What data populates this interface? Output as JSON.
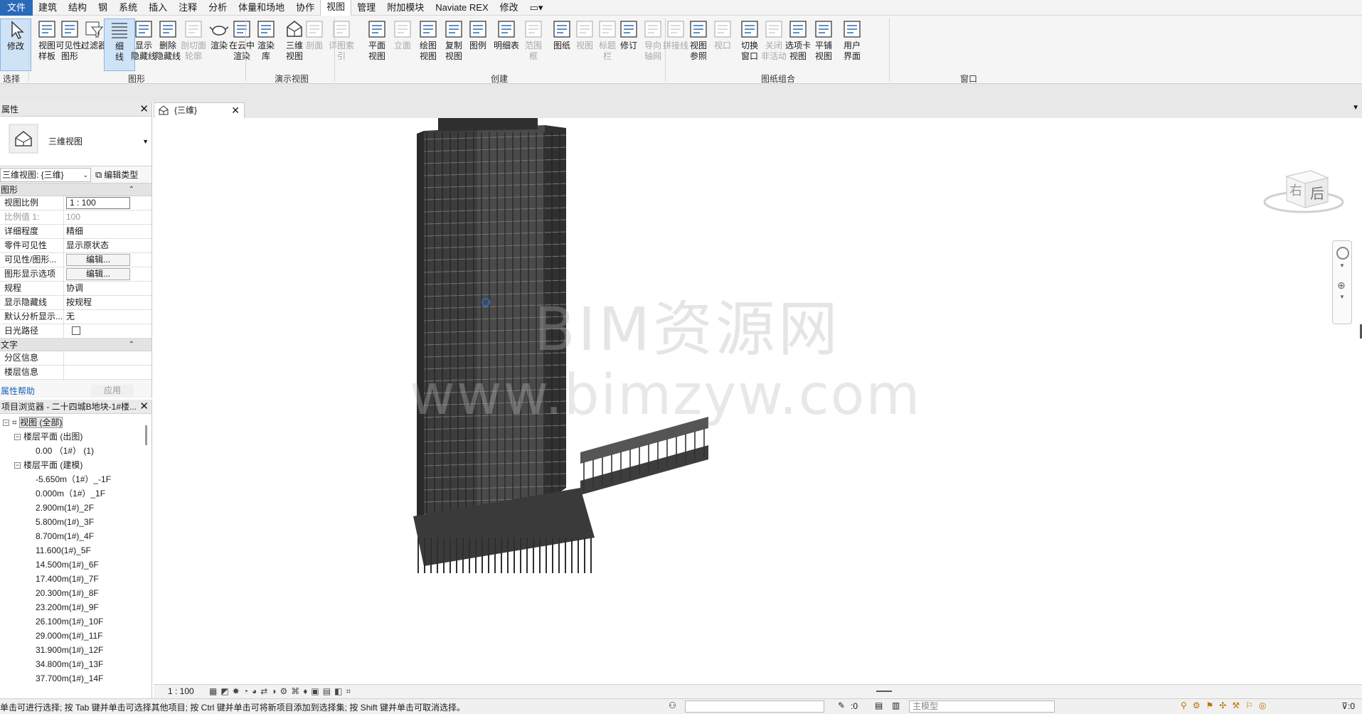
{
  "menu": {
    "tabs": [
      "文件",
      "建筑",
      "结构",
      "钢",
      "系统",
      "插入",
      "注释",
      "分析",
      "体量和场地",
      "协作",
      "视图",
      "管理",
      "附加模块",
      "Naviate REX",
      "修改"
    ],
    "active_tab": "视图"
  },
  "ribbon": {
    "buttons": [
      {
        "label": "修改",
        "icon": "cursor-icon",
        "enabled": true
      },
      {
        "label": "视图\n样板",
        "icon": "view-template-icon",
        "enabled": true
      },
      {
        "label": "可见性/\n图形",
        "icon": "visibility-graphics-icon",
        "enabled": true
      },
      {
        "label": "过滤器",
        "icon": "filter-icon",
        "enabled": true
      },
      {
        "label": "细\n线",
        "icon": "thin-lines-icon",
        "enabled": true
      },
      {
        "label": "显示\n隐藏线",
        "icon": "show-hidden-lines-icon",
        "enabled": true
      },
      {
        "label": "删除\n隐藏线",
        "icon": "remove-hidden-lines-icon",
        "enabled": true
      },
      {
        "label": "剖切面\n轮廓",
        "icon": "cut-profile-icon",
        "enabled": false
      },
      {
        "label": "渲染",
        "icon": "render-teapot-icon",
        "enabled": true
      },
      {
        "label": "在云中\n渲染",
        "icon": "cloud-render-icon",
        "enabled": true
      },
      {
        "label": "渲染\n库",
        "icon": "render-gallery-icon",
        "enabled": true
      },
      {
        "label": "三维\n视图",
        "icon": "3d-view-house-icon",
        "enabled": true
      },
      {
        "label": "剖面",
        "icon": "section-icon",
        "enabled": false
      },
      {
        "label": "详图索引",
        "icon": "callout-icon",
        "enabled": false
      },
      {
        "label": "平面\n视图",
        "icon": "plan-view-icon",
        "enabled": true
      },
      {
        "label": "立面",
        "icon": "elevation-icon",
        "enabled": false
      },
      {
        "label": "绘图\n视图",
        "icon": "drafting-view-icon",
        "enabled": true
      },
      {
        "label": "复制\n视图",
        "icon": "duplicate-view-icon",
        "enabled": true
      },
      {
        "label": "图例",
        "icon": "legend-icon",
        "enabled": true
      },
      {
        "label": "明细表",
        "icon": "schedule-icon",
        "enabled": true
      },
      {
        "label": "范围\n框",
        "icon": "scope-box-icon",
        "enabled": false
      },
      {
        "label": "图纸",
        "icon": "sheet-icon",
        "enabled": true
      },
      {
        "label": "视图",
        "icon": "place-view-icon",
        "enabled": false
      },
      {
        "label": "标题\n栏",
        "icon": "title-block-icon",
        "enabled": false
      },
      {
        "label": "修订",
        "icon": "revision-icon",
        "enabled": true
      },
      {
        "label": "导向\n轴网",
        "icon": "guide-grid-icon",
        "enabled": false
      },
      {
        "label": "拼接线",
        "icon": "matchline-icon",
        "enabled": false
      },
      {
        "label": "视图\n参照",
        "icon": "view-reference-icon",
        "enabled": true
      },
      {
        "label": "视口",
        "icon": "viewport-icon",
        "enabled": false
      },
      {
        "label": "切换\n窗口",
        "icon": "switch-windows-icon",
        "enabled": true
      },
      {
        "label": "关闭\n非活动",
        "icon": "close-inactive-icon",
        "enabled": false
      },
      {
        "label": "选项卡\n视图",
        "icon": "tab-views-icon",
        "enabled": true
      },
      {
        "label": "平铺\n视图",
        "icon": "tile-views-icon",
        "enabled": true
      },
      {
        "label": "用户\n界面",
        "icon": "user-interface-icon",
        "enabled": true
      }
    ],
    "panels": [
      "选择",
      "图形",
      "演示视图",
      "创建",
      "图纸组合",
      "窗口"
    ]
  },
  "properties": {
    "title": "属性",
    "type_name": "三维视图",
    "view_selector": "三维视图: {三维}",
    "edit_type": "编辑类型",
    "sections": [
      {
        "name": "图形",
        "rows": [
          {
            "name": "视图比例",
            "value": "1 : 100",
            "style": "box"
          },
          {
            "name": "比例值 1:",
            "value": "100",
            "style": "gray"
          },
          {
            "name": "详细程度",
            "value": "精细",
            "style": "text"
          },
          {
            "name": "零件可见性",
            "value": "显示原状态",
            "style": "text"
          },
          {
            "name": "可见性/图形...",
            "value": "编辑...",
            "style": "button"
          },
          {
            "name": "图形显示选项",
            "value": "编辑...",
            "style": "button"
          },
          {
            "name": "规程",
            "value": "协调",
            "style": "text"
          },
          {
            "name": "显示隐藏线",
            "value": "按规程",
            "style": "text"
          },
          {
            "name": "默认分析显示...",
            "value": "无",
            "style": "text"
          },
          {
            "name": "日光路径",
            "value": "",
            "style": "checkbox"
          }
        ]
      },
      {
        "name": "文字",
        "rows": [
          {
            "name": "分区信息",
            "value": "",
            "style": "text"
          },
          {
            "name": "楼层信息",
            "value": "",
            "style": "text"
          }
        ]
      }
    ],
    "help_link": "属性帮助",
    "apply_button": "应用"
  },
  "browser": {
    "title": "项目浏览器 - 二十四城B地块-1#楼...",
    "items": [
      {
        "label": "视图 (全部)",
        "level": 0,
        "toggle": "−"
      },
      {
        "label": "楼层平面 (出图)",
        "level": 1,
        "toggle": "−"
      },
      {
        "label": "0.00 （1#） (1)",
        "level": 2,
        "toggle": ""
      },
      {
        "label": "楼层平面 (建模)",
        "level": 1,
        "toggle": "−"
      },
      {
        "label": "-5.650m（1#）_-1F",
        "level": 2,
        "toggle": ""
      },
      {
        "label": "0.000m（1#）_1F",
        "level": 2,
        "toggle": ""
      },
      {
        "label": "2.900m(1#)_2F",
        "level": 2,
        "toggle": ""
      },
      {
        "label": "5.800m(1#)_3F",
        "level": 2,
        "toggle": ""
      },
      {
        "label": "8.700m(1#)_4F",
        "level": 2,
        "toggle": ""
      },
      {
        "label": "11.600(1#)_5F",
        "level": 2,
        "toggle": ""
      },
      {
        "label": "14.500m(1#)_6F",
        "level": 2,
        "toggle": ""
      },
      {
        "label": "17.400m(1#)_7F",
        "level": 2,
        "toggle": ""
      },
      {
        "label": "20.300m(1#)_8F",
        "level": 2,
        "toggle": ""
      },
      {
        "label": "23.200m(1#)_9F",
        "level": 2,
        "toggle": ""
      },
      {
        "label": "26.100m(1#)_10F",
        "level": 2,
        "toggle": ""
      },
      {
        "label": "29.000m(1#)_11F",
        "level": 2,
        "toggle": ""
      },
      {
        "label": "31.900m(1#)_12F",
        "level": 2,
        "toggle": ""
      },
      {
        "label": "34.800m(1#)_13F",
        "level": 2,
        "toggle": ""
      },
      {
        "label": "37.700m(1#)_14F",
        "level": 2,
        "toggle": ""
      }
    ]
  },
  "view": {
    "tab_label": "{三维}",
    "scale": "1 : 100",
    "watermark_cn": "BIM资源网",
    "watermark_url": "www.bimzyw.com",
    "viewcube_face": "后"
  },
  "statusbar": {
    "message": "单击可进行选择; 按 Tab 键并单击可选择其他项目; 按 Ctrl 键并单击可将新项目添加到选择集; 按 Shift 键并单击可取消选择。",
    "count": ":0",
    "model": "主模型",
    "filter_count": ":0"
  },
  "colors": {
    "accent": "#2a6ab8",
    "selected": "#cfe3f7",
    "building": "#3c3c3c"
  }
}
